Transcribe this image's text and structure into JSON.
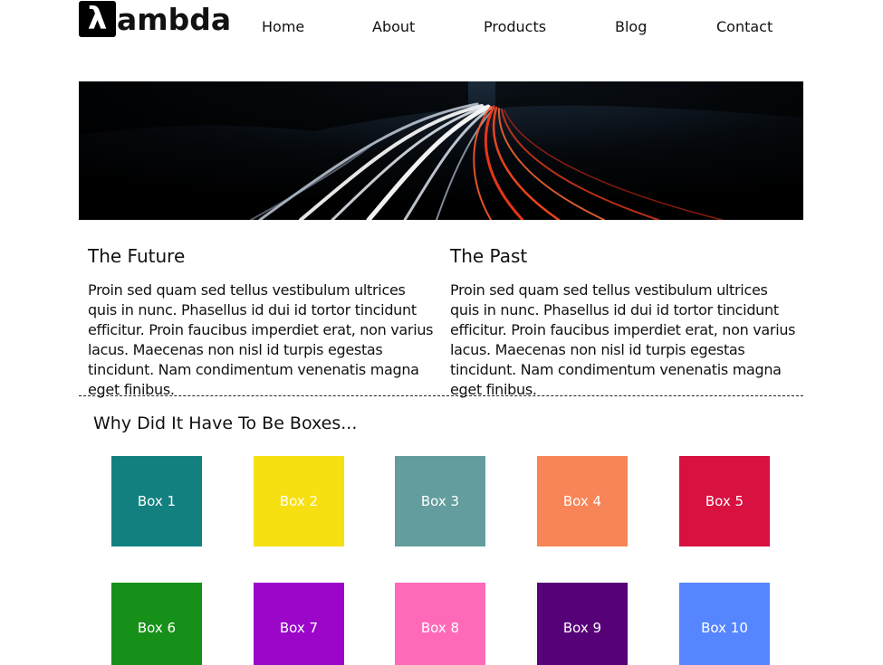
{
  "header": {
    "logo_symbol": "λ",
    "logo_text": "ambda",
    "nav": [
      "Home",
      "About",
      "Products",
      "Blog",
      "Contact"
    ]
  },
  "columns": [
    {
      "title": "The Future",
      "body": "Proin sed quam sed tellus vestibulum ultrices quis in nunc. Phasellus id dui id tortor tincidunt efficitur. Proin faucibus imperdiet erat, non varius lacus. Maecenas non nisl id turpis egestas tincidunt. Nam condimentum venenatis magna eget finibus."
    },
    {
      "title": "The Past",
      "body": "Proin sed quam sed tellus vestibulum ultrices quis in nunc. Phasellus id dui id tortor tincidunt efficitur. Proin faucibus imperdiet erat, non varius lacus. Maecenas non nisl id turpis egestas tincidunt. Nam condimentum venenatis magna eget finibus."
    }
  ],
  "boxes_section": {
    "title": "Why Did It Have To Be Boxes...",
    "boxes": [
      {
        "label": "Box 1",
        "color": "#138080"
      },
      {
        "label": "Box 2",
        "color": "#f7e012"
      },
      {
        "label": "Box 3",
        "color": "#639d9d"
      },
      {
        "label": "Box 4",
        "color": "#f78557"
      },
      {
        "label": "Box 5",
        "color": "#d81140"
      },
      {
        "label": "Box 6",
        "color": "#17901a"
      },
      {
        "label": "Box 7",
        "color": "#9b06c9"
      },
      {
        "label": "Box 8",
        "color": "#ff6ab8"
      },
      {
        "label": "Box 9",
        "color": "#560178"
      },
      {
        "label": "Box 10",
        "color": "#5585ff"
      }
    ]
  }
}
